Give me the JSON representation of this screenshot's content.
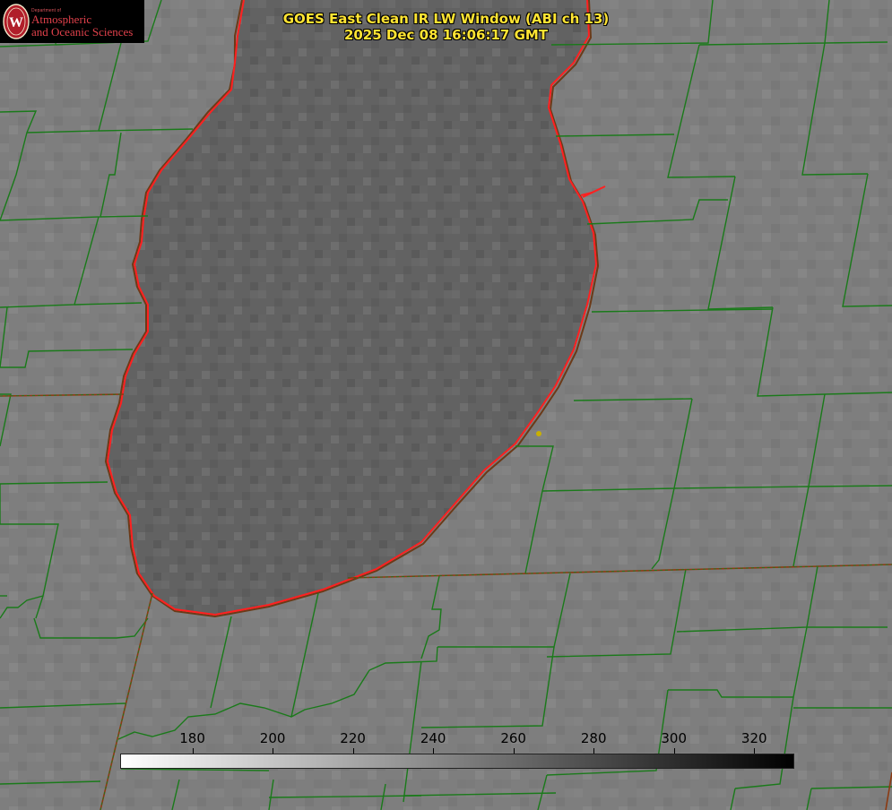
{
  "title": {
    "line1": "GOES East Clean IR LW Window (ABI ch 13)",
    "line2": "2025 Dec 08 16:06:17 GMT"
  },
  "logo": {
    "department": "Department of",
    "line1": "Atmospheric",
    "line2": "and Oceanic Sciences",
    "shield_letter": "W"
  },
  "colorbar": {
    "ticks": [
      "180",
      "200",
      "220",
      "240",
      "260",
      "280",
      "300",
      "320"
    ],
    "tick_values": [
      180,
      200,
      220,
      240,
      260,
      280,
      300,
      320
    ],
    "range": [
      162,
      330
    ],
    "gradient": [
      "#ffffff",
      "#000000"
    ]
  },
  "colors": {
    "lake_outline": "#ff2020",
    "county_lines": "#1a7a1a",
    "state_lines": "#8b3a12",
    "title_text": "#ffe433",
    "marker": "#c8b000"
  },
  "map": {
    "feature": "Lake Michigan (southern basin)"
  }
}
